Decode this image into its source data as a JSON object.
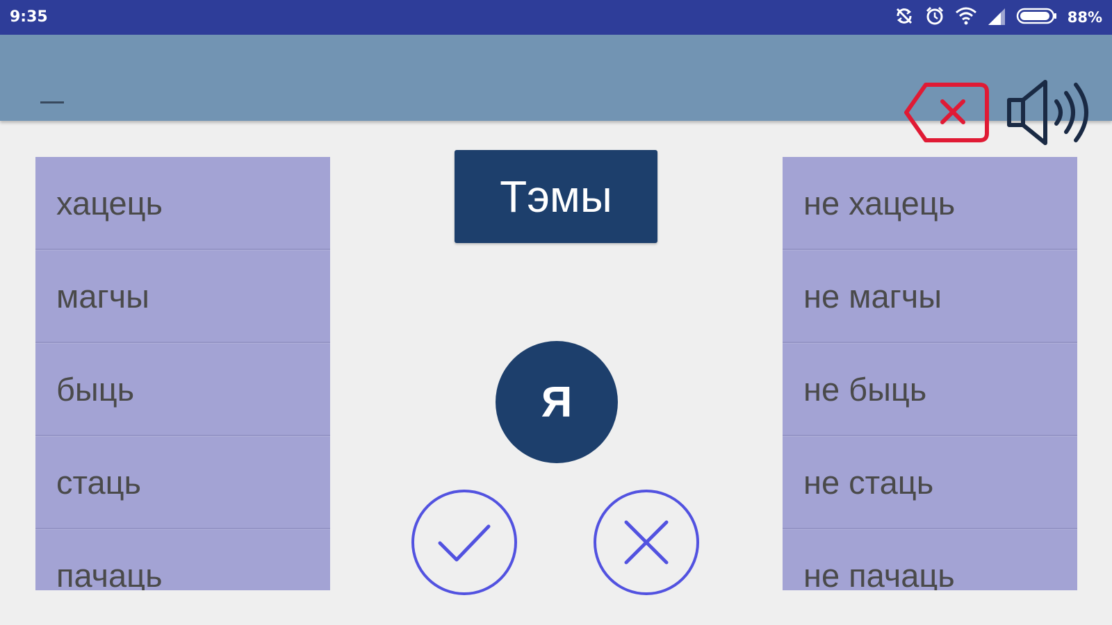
{
  "status_bar": {
    "time": "9:35",
    "battery_percent": "88%",
    "icons": [
      "sync-off-icon",
      "alarm-icon",
      "wifi-icon",
      "cell-signal-icon",
      "battery-icon"
    ]
  },
  "toolbar": {
    "input_text": "_",
    "clear_button_icon": "backspace-clear-icon",
    "sound_button_icon": "speaker-icon"
  },
  "colors": {
    "status_bar": "#2e3d99",
    "toolbar": "#7294b3",
    "list_background": "#a3a3d4",
    "primary_button": "#1d3f6c",
    "outline_button": "#5252e0",
    "clear_icon": "#e01a34"
  },
  "left_list": {
    "items": [
      "хацець",
      "магчы",
      "быць",
      "стаць",
      "пачаць"
    ]
  },
  "right_list": {
    "items": [
      "не хацець",
      "не магчы",
      "не быць",
      "не стаць",
      "не пачаць"
    ]
  },
  "topics_button": {
    "label": "Тэмы"
  },
  "pronoun_button": {
    "label": "Я"
  },
  "confirm_button": {
    "icon": "check-icon"
  },
  "cancel_button": {
    "icon": "close-icon"
  }
}
